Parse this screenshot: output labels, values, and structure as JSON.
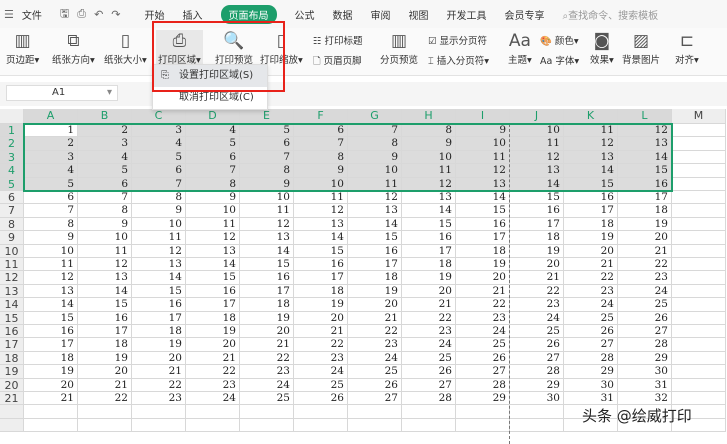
{
  "tabs": {
    "file": "文件",
    "items": [
      "开始",
      "插入",
      "页面布局",
      "公式",
      "数据",
      "审阅",
      "视图",
      "开发工具",
      "会员专享"
    ],
    "active": "页面布局",
    "search_placeholder": "查找命令、搜索模板"
  },
  "ribbon": {
    "margins": "页边距",
    "orientation": "纸张方向",
    "size": "纸张大小",
    "print_area": "打印区域",
    "print_preview": "打印预览",
    "print_scale": "打印缩放",
    "print_titles": "打印标题",
    "header_footer": "页眉页脚",
    "page_break_preview": "分页预览",
    "show_page_breaks": "显示分页符",
    "insert_page_break": "插入分页符",
    "theme": "主题",
    "colors": "颜色",
    "fonts": "字体",
    "effects": "效果",
    "background": "背景图片",
    "align": "对齐"
  },
  "menu": {
    "items": [
      "设置打印区域(S)",
      "取消打印区域(C)"
    ],
    "highlighted": 0
  },
  "name_box": "A1",
  "sheet": {
    "columns": [
      "A",
      "B",
      "C",
      "D",
      "E",
      "F",
      "G",
      "H",
      "I",
      "J",
      "K",
      "L",
      "M"
    ],
    "rows": [
      [
        1,
        2,
        3,
        4,
        5,
        6,
        7,
        8,
        9,
        10,
        11,
        12
      ],
      [
        2,
        3,
        4,
        5,
        6,
        7,
        8,
        9,
        10,
        11,
        12,
        13
      ],
      [
        3,
        4,
        5,
        6,
        7,
        8,
        9,
        10,
        11,
        12,
        13,
        14
      ],
      [
        4,
        5,
        6,
        7,
        8,
        9,
        10,
        11,
        12,
        13,
        14,
        15
      ],
      [
        5,
        6,
        7,
        8,
        9,
        10,
        11,
        12,
        13,
        14,
        15,
        16
      ],
      [
        6,
        7,
        8,
        9,
        10,
        11,
        12,
        13,
        14,
        15,
        16,
        17
      ],
      [
        7,
        8,
        9,
        10,
        11,
        12,
        13,
        14,
        15,
        16,
        17,
        18
      ],
      [
        8,
        9,
        10,
        11,
        12,
        13,
        14,
        15,
        16,
        17,
        18,
        19
      ],
      [
        9,
        10,
        11,
        12,
        13,
        14,
        15,
        16,
        17,
        18,
        19,
        20
      ],
      [
        10,
        11,
        12,
        13,
        14,
        15,
        16,
        17,
        18,
        19,
        20,
        21
      ],
      [
        11,
        12,
        13,
        14,
        15,
        16,
        17,
        18,
        19,
        20,
        21,
        22
      ],
      [
        12,
        13,
        14,
        15,
        16,
        17,
        18,
        19,
        20,
        21,
        22,
        23
      ],
      [
        13,
        14,
        15,
        16,
        17,
        18,
        19,
        20,
        21,
        22,
        23,
        24
      ],
      [
        14,
        15,
        16,
        17,
        18,
        19,
        20,
        21,
        22,
        23,
        24,
        25
      ],
      [
        15,
        16,
        17,
        18,
        19,
        20,
        21,
        22,
        23,
        24,
        25,
        26
      ],
      [
        16,
        17,
        18,
        19,
        20,
        21,
        22,
        23,
        24,
        25,
        26,
        27
      ],
      [
        17,
        18,
        19,
        20,
        21,
        22,
        23,
        24,
        25,
        26,
        27,
        28
      ],
      [
        18,
        19,
        20,
        21,
        22,
        23,
        24,
        25,
        26,
        27,
        28,
        29
      ],
      [
        19,
        20,
        21,
        22,
        23,
        24,
        25,
        26,
        27,
        28,
        29,
        30
      ],
      [
        20,
        21,
        22,
        23,
        24,
        25,
        26,
        27,
        28,
        29,
        30,
        31
      ],
      [
        21,
        22,
        23,
        24,
        25,
        26,
        27,
        28,
        29,
        30,
        31,
        32
      ]
    ],
    "selected_rows": 5
  },
  "watermark": "头条 @绘威打印",
  "colors": {
    "accent": "#1d9e6b",
    "highlight_box": "#e8221a"
  }
}
